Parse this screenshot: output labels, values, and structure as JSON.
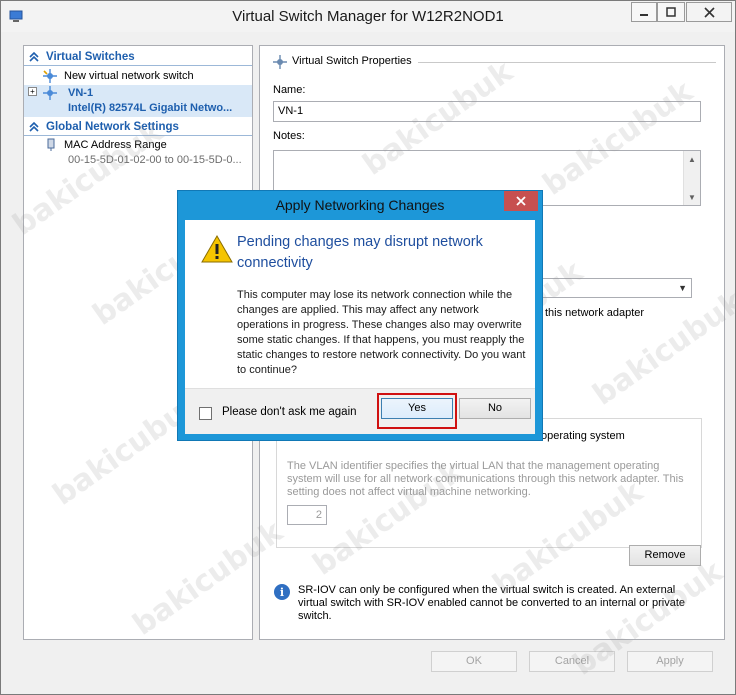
{
  "window": {
    "title": "Virtual Switch Manager for W12R2NOD1",
    "icon": "hyper-v-icon"
  },
  "tree": {
    "switches_header": "Virtual Switches",
    "new_switch": "New virtual network switch",
    "switch_name": "VN-1",
    "switch_adapter": "Intel(R) 82574L Gigabit Netwo...",
    "global_header": "Global Network Settings",
    "mac_label": "MAC Address Range",
    "mac_range": "00-15-5D-01-02-00 to 00-15-5D-0..."
  },
  "props": {
    "section_title": "Virtual Switch Properties",
    "name_label": "Name:",
    "name_value": "VN-1",
    "notes_label": "Notes:",
    "adapter_text": "this network adapter",
    "os_text": "operating system",
    "vlan_desc": "The VLAN identifier specifies the virtual LAN that the management operating system will use for all network communications through this network adapter. This setting does not affect virtual machine networking.",
    "vlan_value": "2",
    "remove_label": "Remove",
    "sriov_info": "SR-IOV can only be configured when the virtual switch is created. An external virtual switch with SR-IOV enabled cannot be converted to an internal or private switch."
  },
  "footer": {
    "ok": "OK",
    "cancel": "Cancel",
    "apply": "Apply"
  },
  "dialog": {
    "title": "Apply Networking Changes",
    "heading": "Pending changes may disrupt network connectivity",
    "body": "This computer may lose its network connection while the changes are applied. This may affect any network operations in progress. These changes also may overwrite some static changes. If that happens, you must reapply the static changes to restore network connectivity. Do you want to continue?",
    "checkbox_label": "Please don't ask me again",
    "yes": "Yes",
    "no": "No"
  },
  "watermark": "bakicubuk",
  "colors": {
    "dialog_frame": "#1d97d8",
    "heading_blue": "#1e4e9e",
    "tree_blue": "#1e5fae",
    "highlight_red": "#d01010"
  }
}
